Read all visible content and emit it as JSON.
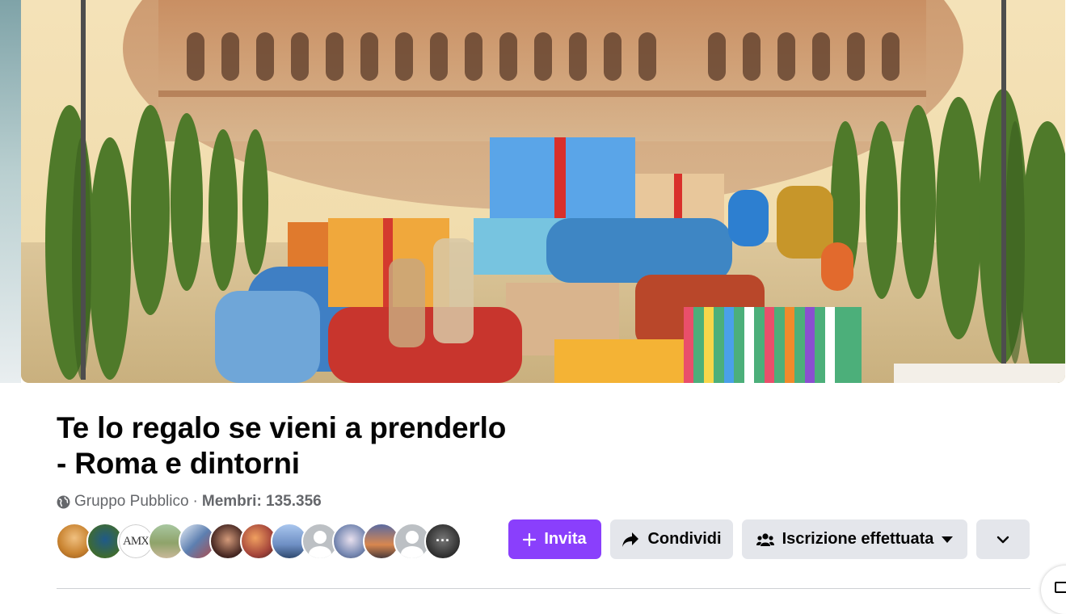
{
  "cover": {
    "alt": "Colosseo con regali"
  },
  "group": {
    "title": "Te lo regalo se vieni a prenderlo - Roma e dintorni",
    "privacy": "Gruppo Pubblico",
    "separator": "·",
    "members_label": "Membri: 135.356"
  },
  "avatars": [
    {
      "kind": "photo",
      "color": "#c8822f"
    },
    {
      "kind": "photo",
      "color": "#3f6b2f"
    },
    {
      "kind": "text",
      "text": "AMX"
    },
    {
      "kind": "photo",
      "color": "#8fa36a"
    },
    {
      "kind": "photo",
      "color": "#5d7fb0"
    },
    {
      "kind": "photo",
      "color": "#4a2a24"
    },
    {
      "kind": "photo",
      "color": "#a4443a"
    },
    {
      "kind": "photo",
      "color": "#6e8fc4"
    },
    {
      "kind": "gray"
    },
    {
      "kind": "photo",
      "color": "#7a8bb4"
    },
    {
      "kind": "photo",
      "color": "#d8874f"
    },
    {
      "kind": "gray"
    },
    {
      "kind": "more",
      "color": "#2d2d2d"
    }
  ],
  "actions": {
    "invite_label": "Invita",
    "share_label": "Condividi",
    "joined_label": "Iscrizione effettuata"
  },
  "icons": {
    "globe": "globe-icon",
    "plus": "plus-icon",
    "share": "share-arrow-icon",
    "group": "people-icon",
    "caret": "caret-down-icon",
    "chevron": "chevron-down-icon"
  },
  "colors": {
    "accent": "#8a3ffc",
    "button_gray": "#e4e6eb",
    "text_primary": "#050505",
    "text_secondary": "#65676b"
  }
}
